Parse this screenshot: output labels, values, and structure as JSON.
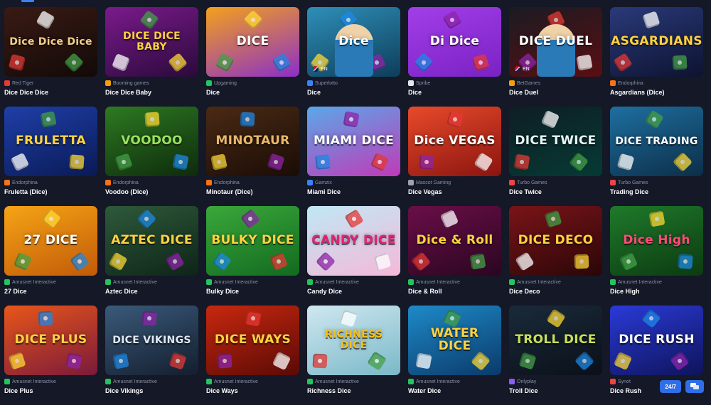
{
  "games": [
    {
      "name": "Dice Dice Dice",
      "provider": "Red Tiger",
      "thumb_text": "Dice Dice Dice",
      "bg": "#3a1a14",
      "bg2": "#120a08",
      "text_color": "#f3d08a",
      "icon_color": "#e53935"
    },
    {
      "name": "Dice Dice Baby",
      "provider": "Booming games",
      "thumb_text": "DICE DICE BABY",
      "bg": "#7b1a8c",
      "bg2": "#2a0a3a",
      "text_color": "#ffd23f",
      "icon_color": "#f59e0b"
    },
    {
      "name": "Dice",
      "provider": "Upgaming",
      "thumb_text": "DICE",
      "bg": "#f4a01c",
      "bg2": "#8b2fc9",
      "text_color": "#ffffff",
      "icon_color": "#22c55e"
    },
    {
      "name": "Dice",
      "provider": "Superlotto",
      "thumb_text": "Dice",
      "bg": "#2e8fb8",
      "bg2": "#0e3d5a",
      "text_color": "#ffffff",
      "icon_color": "#3b82f6",
      "lang": "EN"
    },
    {
      "name": "Dice",
      "provider": "Spribe",
      "thumb_text": "Di Dice",
      "bg": "#a23ee8",
      "bg2": "#7a22c4",
      "text_color": "#ffffff",
      "icon_color": "#e5e7eb"
    },
    {
      "name": "Dice Duel",
      "provider": "BetGames",
      "thumb_text": "DICE DUEL",
      "bg": "#1b1b22",
      "bg2": "#5a0e12",
      "text_color": "#ffffff",
      "icon_color": "#f59e0b",
      "lang": "EN"
    },
    {
      "name": "Asgardians (Dice)",
      "provider": "Endorphina",
      "thumb_text": "ASGARDIANS",
      "bg": "#2a3a7a",
      "bg2": "#0d1330",
      "text_color": "#ffd23f",
      "icon_color": "#f97316"
    },
    {
      "name": "Fruletta (Dice)",
      "provider": "Endorphina",
      "thumb_text": "FRULETTA",
      "bg": "#1f3fa8",
      "bg2": "#0a1a55",
      "text_color": "#ffd23f",
      "icon_color": "#f97316"
    },
    {
      "name": "Voodoo (Dice)",
      "provider": "Endorphina",
      "thumb_text": "VOODOO",
      "bg": "#2d7a22",
      "bg2": "#0e2a0c",
      "text_color": "#9be15d",
      "icon_color": "#f97316"
    },
    {
      "name": "Minotaur (Dice)",
      "provider": "Endorphina",
      "thumb_text": "MINOTAUR",
      "bg": "#4a2a14",
      "bg2": "#1a0c06",
      "text_color": "#e8b86a",
      "icon_color": "#f97316"
    },
    {
      "name": "Miami Dice",
      "provider": "Gamzix",
      "thumb_text": "MIAMI DICE",
      "bg": "#5aa8e8",
      "bg2": "#c03ab8",
      "text_color": "#ffffff",
      "icon_color": "#3b82f6"
    },
    {
      "name": "Dice Vegas",
      "provider": "Mascot Gaming",
      "thumb_text": "Dice VEGAS",
      "bg": "#e84a2a",
      "bg2": "#8a1410",
      "text_color": "#ffffff",
      "icon_color": "#9ca3af"
    },
    {
      "name": "Dice Twice",
      "provider": "Turbo Games",
      "thumb_text": "DICE TWICE",
      "bg": "#0e1e24",
      "bg2": "#063a34",
      "text_color": "#e6f7f5",
      "icon_color": "#ef4444"
    },
    {
      "name": "Trading Dice",
      "provider": "Turbo Games",
      "thumb_text": "DICE TRADING",
      "bg": "#1e6fa0",
      "bg2": "#0c2e48",
      "text_color": "#ffffff",
      "icon_color": "#ef4444"
    },
    {
      "name": "27 Dice",
      "provider": "Amusnet Interactive",
      "thumb_text": "27 DICE",
      "bg": "#f5a416",
      "bg2": "#c25a08",
      "text_color": "#ffffff",
      "icon_color": "#22c55e"
    },
    {
      "name": "Aztec Dice",
      "provider": "Amusnet Interactive",
      "thumb_text": "AZTEC DICE",
      "bg": "#2e5a3a",
      "bg2": "#0e2418",
      "text_color": "#ffd23f",
      "icon_color": "#22c55e"
    },
    {
      "name": "Bulky Dice",
      "provider": "Amusnet Interactive",
      "thumb_text": "BULKY DICE",
      "bg": "#3aa83a",
      "bg2": "#136a20",
      "text_color": "#ffd23f",
      "icon_color": "#22c55e"
    },
    {
      "name": "Candy Dice",
      "provider": "Amusnet Interactive",
      "thumb_text": "CANDY DICE",
      "bg": "#bfe8f5",
      "bg2": "#f5b8d8",
      "text_color": "#e0247a",
      "icon_color": "#22c55e"
    },
    {
      "name": "Dice & Roll",
      "provider": "Amusnet Interactive",
      "thumb_text": "Dice & Roll",
      "bg": "#6a0e48",
      "bg2": "#2a0620",
      "text_color": "#ffd23f",
      "icon_color": "#22c55e"
    },
    {
      "name": "Dice Deco",
      "provider": "Amusnet Interactive",
      "thumb_text": "DICE DECO",
      "bg": "#7a1418",
      "bg2": "#2a0608",
      "text_color": "#ffd23f",
      "icon_color": "#22c55e"
    },
    {
      "name": "Dice High",
      "provider": "Amusnet Interactive",
      "thumb_text": "Dice High",
      "bg": "#1f7a2a",
      "bg2": "#0c3a12",
      "text_color": "#ff4a7a",
      "icon_color": "#22c55e"
    },
    {
      "name": "Dice Plus",
      "provider": "Amusnet Interactive",
      "thumb_text": "DICE PLUS",
      "bg": "#e8561a",
      "bg2": "#7a1a3a",
      "text_color": "#ffd23f",
      "icon_color": "#22c55e"
    },
    {
      "name": "Dice Vikings",
      "provider": "Amusnet Interactive",
      "thumb_text": "DICE VIKINGS",
      "bg": "#3a5a7a",
      "bg2": "#141e2e",
      "text_color": "#e0e8f5",
      "icon_color": "#22c55e"
    },
    {
      "name": "Dice Ways",
      "provider": "Amusnet Interactive",
      "thumb_text": "DICE WAYS",
      "bg": "#c8280e",
      "bg2": "#5a0a06",
      "text_color": "#ffd23f",
      "icon_color": "#22c55e"
    },
    {
      "name": "Richness Dice",
      "provider": "Amusnet Interactive",
      "thumb_text": "RICHNESS DICE",
      "bg": "#cfe8f0",
      "bg2": "#7ab8c8",
      "text_color": "#f5c21a",
      "icon_color": "#22c55e"
    },
    {
      "name": "Water Dice",
      "provider": "Amusnet Interactive",
      "thumb_text": "WATER DICE",
      "bg": "#1e8ac8",
      "bg2": "#0a3a6a",
      "text_color": "#ffd23f",
      "icon_color": "#22c55e"
    },
    {
      "name": "Troll Dice",
      "provider": "Onlyplay",
      "thumb_text": "TROLL DICE",
      "bg": "#1a2a3a",
      "bg2": "#0a1018",
      "text_color": "#c8e05a",
      "icon_color": "#8b5cf6"
    },
    {
      "name": "Dice Rush",
      "provider": "Synot",
      "thumb_text": "DICE RUSH",
      "bg": "#2a3ad8",
      "bg2": "#0e145a",
      "text_color": "#ffffff",
      "icon_color": "#ef4444"
    }
  ],
  "help": {
    "label": "24/7"
  }
}
